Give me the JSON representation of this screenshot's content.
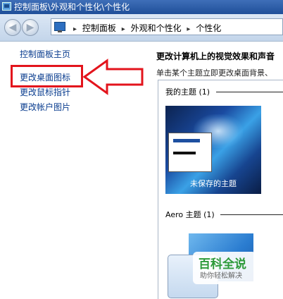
{
  "window": {
    "title": "控制面板\\外观和个性化\\个性化"
  },
  "address_bar": {
    "crumbs": [
      "控制面板",
      "外观和个性化",
      "个性化"
    ]
  },
  "sidebar": {
    "items": [
      {
        "label": "控制面板主页"
      },
      {
        "label": "更改桌面图标"
      },
      {
        "label": "更改鼠标指针"
      },
      {
        "label": "更改帐户图片"
      }
    ]
  },
  "main": {
    "heading": "更改计算机上的视觉效果和声音",
    "subtext": "单击某个主题立即更改桌面背景、",
    "groups": [
      {
        "title": "我的主题 (1)"
      },
      {
        "title": "Aero 主题 (1)"
      }
    ],
    "unsaved_theme_label": "未保存的主题"
  },
  "annotation": {
    "color": "#e3141c"
  },
  "watermark": {
    "title": "百科全说",
    "subtitle": "助你轻松解决"
  }
}
